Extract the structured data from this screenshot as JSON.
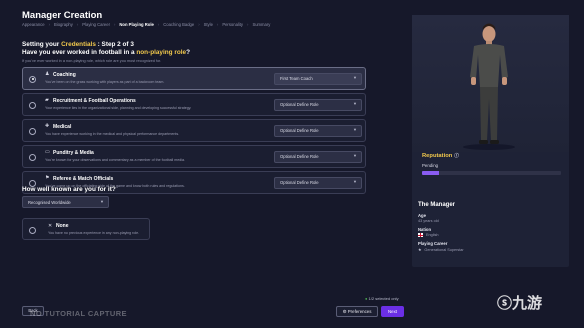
{
  "header": {
    "title": "Manager Creation",
    "breadcrumb": [
      "Appearance",
      "Biography",
      "Playing Career",
      "Non Playing Role",
      "Coaching Badge",
      "Style",
      "Personality",
      "Summary"
    ],
    "breadcrumb_active_index": 3
  },
  "step": {
    "prefix": "Setting your ",
    "highlight": "Credentials",
    "suffix": " : Step 2 of 3"
  },
  "question": {
    "prefix": "Have you ever worked in football in a ",
    "highlight": "non-playing role",
    "suffix": "?",
    "hint": "If you've ever worked in a non-playing role, which role are you most recognized for."
  },
  "roles": [
    {
      "icon": "whistle-icon",
      "glyph": "♟",
      "name": "Coaching",
      "desc": "You've been on the grass working with players as part of a backroom team.",
      "select": "First Team Coach",
      "selected": true
    },
    {
      "icon": "briefcase-icon",
      "glyph": "▰",
      "name": "Recruitment & Football Operations",
      "desc": "Your experience lies in the organizational side, planning and developing successful strategy.",
      "select": "Optional Define Role",
      "selected": false
    },
    {
      "icon": "medical-icon",
      "glyph": "✚",
      "name": "Medical",
      "desc": "You have experience working in the medical and physical performance departments.",
      "select": "Optional Define Role",
      "selected": false
    },
    {
      "icon": "tv-icon",
      "glyph": "▭",
      "name": "Punditry & Media",
      "desc": "You're known for your observations and commentary as a member of the football media.",
      "select": "Optional Define Role",
      "selected": false
    },
    {
      "icon": "referee-icon",
      "glyph": "⚑",
      "name": "Referee & Match Officials",
      "desc": "You've come up on the officiating side of the game and know both rules and regulations.",
      "select": "Optional Define Role",
      "selected": false
    }
  ],
  "known": {
    "question": "How well known are you for it?",
    "value": "Recognised Worldwide"
  },
  "none_option": {
    "glyph": "✕",
    "name": "None",
    "desc": "You have no previous experience in any non-playing role."
  },
  "footer": {
    "back": "Back",
    "watermark": "NO TUTORIAL CAPTURE",
    "selected_count": "1/2 selected only",
    "preferences": "Preferences",
    "next": "Next",
    "logo": "九游"
  },
  "profile": {
    "reputation_label": "Reputation",
    "reputation_status": "Pending",
    "reputation_fill": 0.12,
    "name": "The Manager",
    "age_label": "Age",
    "age_value": "43 years old",
    "nation_label": "Nation",
    "nation_value": "English",
    "career_label": "Playing Career",
    "career_value": "Generational Superstar"
  },
  "colors": {
    "accent_yellow": "#f2c94c",
    "accent_purple": "#6b2fe6",
    "reputation_fill": "#8a5cf2",
    "background": "#16182a"
  }
}
